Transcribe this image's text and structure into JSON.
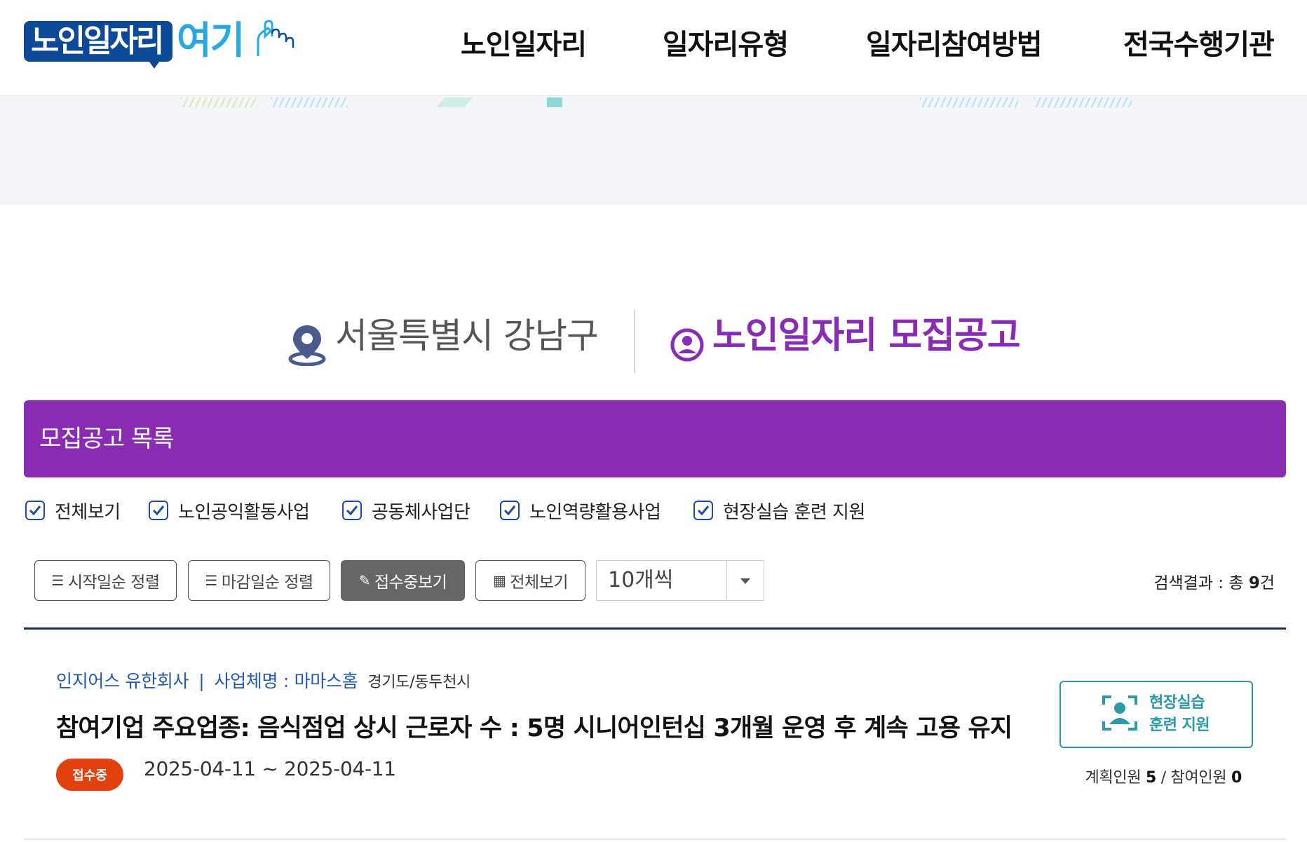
{
  "header": {
    "logo_main": "노인일자리",
    "logo_sub": "여기",
    "nav": [
      "노인일자리",
      "일자리유형",
      "일자리참여방법",
      "전국수행기관"
    ]
  },
  "page": {
    "location": "서울특별시 강남구",
    "title": "노인일자리 모집공고"
  },
  "banner": {
    "label": "모집공고 목록"
  },
  "filters": [
    {
      "label": "전체보기",
      "checked": true
    },
    {
      "label": "노인공익활동사업",
      "checked": true
    },
    {
      "label": "공동체사업단",
      "checked": true
    },
    {
      "label": "노인역량활용사업",
      "checked": true
    },
    {
      "label": "현장실습 훈련 지원",
      "checked": true
    }
  ],
  "toolbar": {
    "sort_start": "시작일순 정렬",
    "sort_end": "마감일순 정렬",
    "receiving": "접수중보기",
    "view_all": "전체보기",
    "page_size": "10개씩",
    "result_prefix": "검색결과 : 총 ",
    "result_count": "9",
    "result_suffix": "건"
  },
  "listing": {
    "company": "인지어스 유한회사",
    "separator": "|",
    "business": "사업체명 : 마마스홈",
    "region": "경기도/동두천시",
    "title": "참여기업 주요업종: 음식점업 상시 근로자 수 : 5명 시니어인턴십 3개월 운영 후 계속 고용 유지",
    "status": "접수중",
    "dates": "2025-04-11 ~ 2025-04-11",
    "support_line1": "현장실습",
    "support_line2": "훈련 지원",
    "planned_label": "계획인원",
    "planned": "5",
    "participants_label": "참여인원",
    "participants": "0"
  },
  "colors": {
    "brand_purple": "#8a2cb3",
    "logo_blue": "#0c4a97",
    "logo_cyan": "#29a9e4",
    "badge_red": "#e0410f",
    "teal": "#2a9aa6",
    "link_blue": "#1f58b5",
    "checkbox_blue": "#1f4aa8"
  },
  "icons": {
    "location": "map-pin-icon",
    "title": "user-circle-icon",
    "sort": "list-icon",
    "edit": "pencil-icon",
    "grid": "grid-icon",
    "support": "person-scan-icon"
  }
}
